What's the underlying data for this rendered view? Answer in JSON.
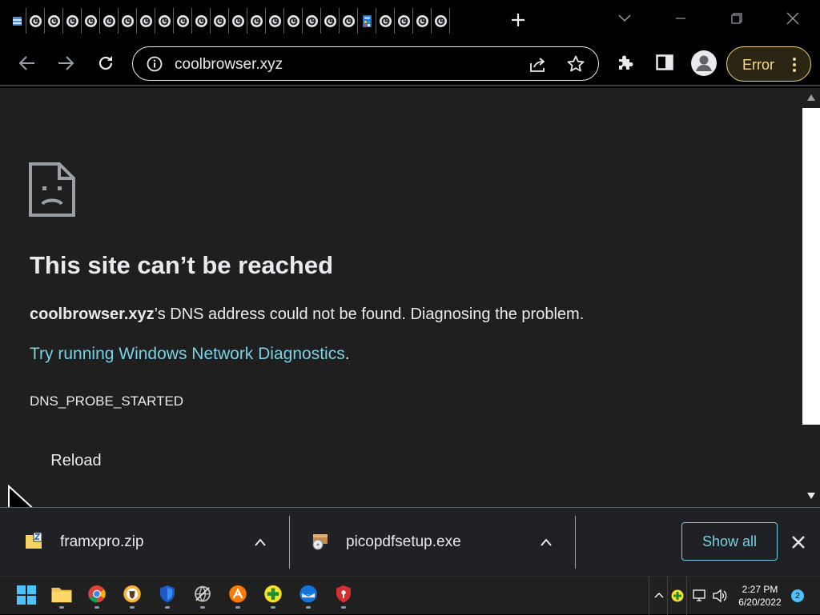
{
  "browser": {
    "tab_count": 24,
    "url": "coolbrowser.xyz",
    "error_label": "Error"
  },
  "page": {
    "title": "This site can’t be reached",
    "domain": "coolbrowser.xyz",
    "description_rest": "’s DNS address could not be found. Diagnosing the problem.",
    "diag_link": "Try running Windows Network Diagnostics",
    "diag_suffix": ".",
    "error_code": "DNS_PROBE_STARTED",
    "reload_label": "Reload"
  },
  "downloads": {
    "items": [
      {
        "name": "framxpro.zip"
      },
      {
        "name": "picopdfsetup.exe"
      }
    ],
    "show_all_label": "Show all"
  },
  "taskbar": {
    "time": "2:27 PM",
    "date": "6/20/2022",
    "notifications": "2"
  },
  "colors": {
    "link": "#7ad0e4",
    "error_pill": "#f1d27a",
    "page_bg": "#1f1f1f"
  }
}
